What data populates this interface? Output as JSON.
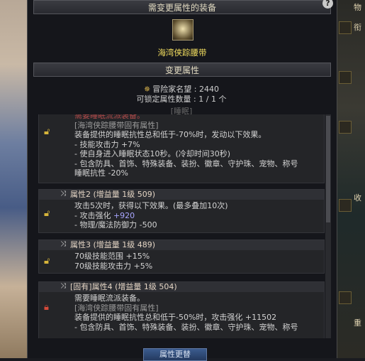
{
  "header": {
    "title": "需变更属性的装备",
    "help": "?"
  },
  "item": {
    "name": "海湾侠踪腰带"
  },
  "section2": {
    "title": "变更属性"
  },
  "stats": {
    "fame_label": "冒险家名望 : 2440",
    "lock_count": "可锁定属性数量 :   1 / 1 个",
    "tag": "[睡眠]"
  },
  "rows": [
    {
      "lines": [
        "需要睡眠流派装备。",
        "[海湾侠踪腰带固有属性]",
        "装备提供的睡眠抗性总和低于-70%时，发动以下效果。",
        "- 技能攻击力 +7%",
        "- 使自身进入睡眠状态10秒。(冷却时间30秒)",
        "- 包含防具、首饰、特殊装备、装扮、徽章、守护珠、宠物、称号",
        "睡眠抗性 -20%"
      ]
    },
    {
      "head": "属性2 (增益量 1级 509)",
      "lines": [
        "攻击5次时，获得以下效果。(最多叠加10次)",
        "- 攻击强化 +920",
        "- 物理/魔法防御力 -500"
      ]
    },
    {
      "head": "属性3 (增益量 1级 489)",
      "lines": [
        "70级技能范围 +15%",
        "70级技能攻击力 +5%"
      ]
    },
    {
      "head": "[固有]属性4 (增益量 1级 504)",
      "lines": [
        "需要睡眠流派装备。",
        "[海湾侠踪腰带固有属性]",
        "装备提供的睡眠抗性总和低于-50%时，攻击强化 +11502",
        "- 包含防具、首饰、特殊装备、装扮、徽章、守护珠、宠物、称号"
      ]
    }
  ],
  "bottom_button": "属性更替",
  "right_side": {
    "labels": [
      "物",
      "衔",
      "收",
      "重"
    ]
  }
}
